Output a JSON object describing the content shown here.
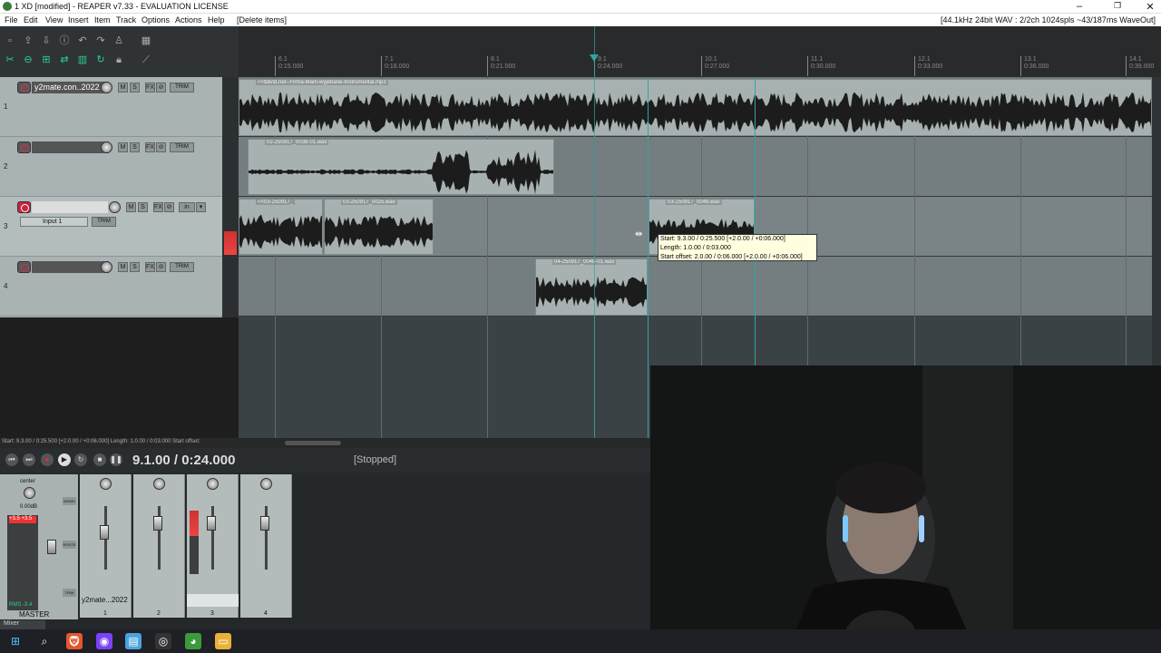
{
  "window": {
    "title": "1 XD [modified] - REAPER v7.33 - EVALUATION LICENSE"
  },
  "menu": {
    "items": [
      "File",
      "Edit",
      "View",
      "Insert",
      "Item",
      "Track",
      "Options",
      "Actions",
      "Help",
      "[Delete items]"
    ],
    "status": "[44.1kHz 24bit WAV : 2/2ch 1024spls ~43/187ms WaveOut]"
  },
  "ruler": {
    "ticks": [
      {
        "bar": "6.1",
        "time": "0:15.000"
      },
      {
        "bar": "7.1",
        "time": "0:18.000"
      },
      {
        "bar": "8.1",
        "time": "0:21.000"
      },
      {
        "bar": "9.1",
        "time": "0:24.000"
      },
      {
        "bar": "10.1",
        "time": "0:27.000"
      },
      {
        "bar": "11.1",
        "time": "0:30.000"
      },
      {
        "bar": "12.1",
        "time": "0:33.000"
      },
      {
        "bar": "13.1",
        "time": "0:36.000"
      },
      {
        "bar": "14.1",
        "time": "0:39.000"
      }
    ]
  },
  "tracks": [
    {
      "num": "1",
      "name": "y2mate.con..2022",
      "trim": "TRIM"
    },
    {
      "num": "2",
      "name": "",
      "trim": "TRIM"
    },
    {
      "num": "3",
      "name": "",
      "trim": "TRIM",
      "input": "Input 1",
      "mode": "in"
    },
    {
      "num": "4",
      "name": "",
      "trim": "TRIM"
    }
  ],
  "buttons": {
    "m": "M",
    "s": "S",
    "fx": "FX",
    "i": "i"
  },
  "items": {
    "t1": "<<$$vid.net--Firma-Mam-wyjebane-Instrumental.mp3",
    "t2": "02-250917_0038-01.wav",
    "t3a": "<<03-250917_",
    "t3b": "03-250917_0025.wav",
    "t3c": "03-250917_0048.wav",
    "t4": "04-250917_0040-01.wav"
  },
  "tooltip": {
    "line1": "Start: 9.3.00 / 0:25.500 [+2.0.00 / +0:06.000]",
    "line2": "Length: 1.0.00 / 0:03.000",
    "line3": "Start offset: 2.0.00 / 0:06.000 [+2.0.00 / +0:06.000]"
  },
  "statusline": "Start: 9.3.00 / 0:25.500 [+2.0.00 / +0:06.000] Length: 1.0.00 / 0:03.000 Start offset:",
  "transport": {
    "clock": "9.1.00 / 0:24.000",
    "state": "[Stopped]"
  },
  "mixer": {
    "master_label": "MASTER",
    "master_pan": "center",
    "master_vol": "0.00dB",
    "master_rms": "RMS",
    "master_rms_val": "-3.4",
    "master_peak_l": "+3.5",
    "master_peak_r": "+3.5",
    "side_buttons": [
      "MONO",
      "ROUTE",
      "TRIM"
    ],
    "strip_name": "y2mate...2022",
    "strips": [
      "1",
      "2",
      "3",
      "4"
    ],
    "tab": "Mixer"
  },
  "colors": {
    "accent": "#2cd28c",
    "record": "#c9233f",
    "playhead": "#2ea7a0",
    "item": "#a8b1b1"
  }
}
